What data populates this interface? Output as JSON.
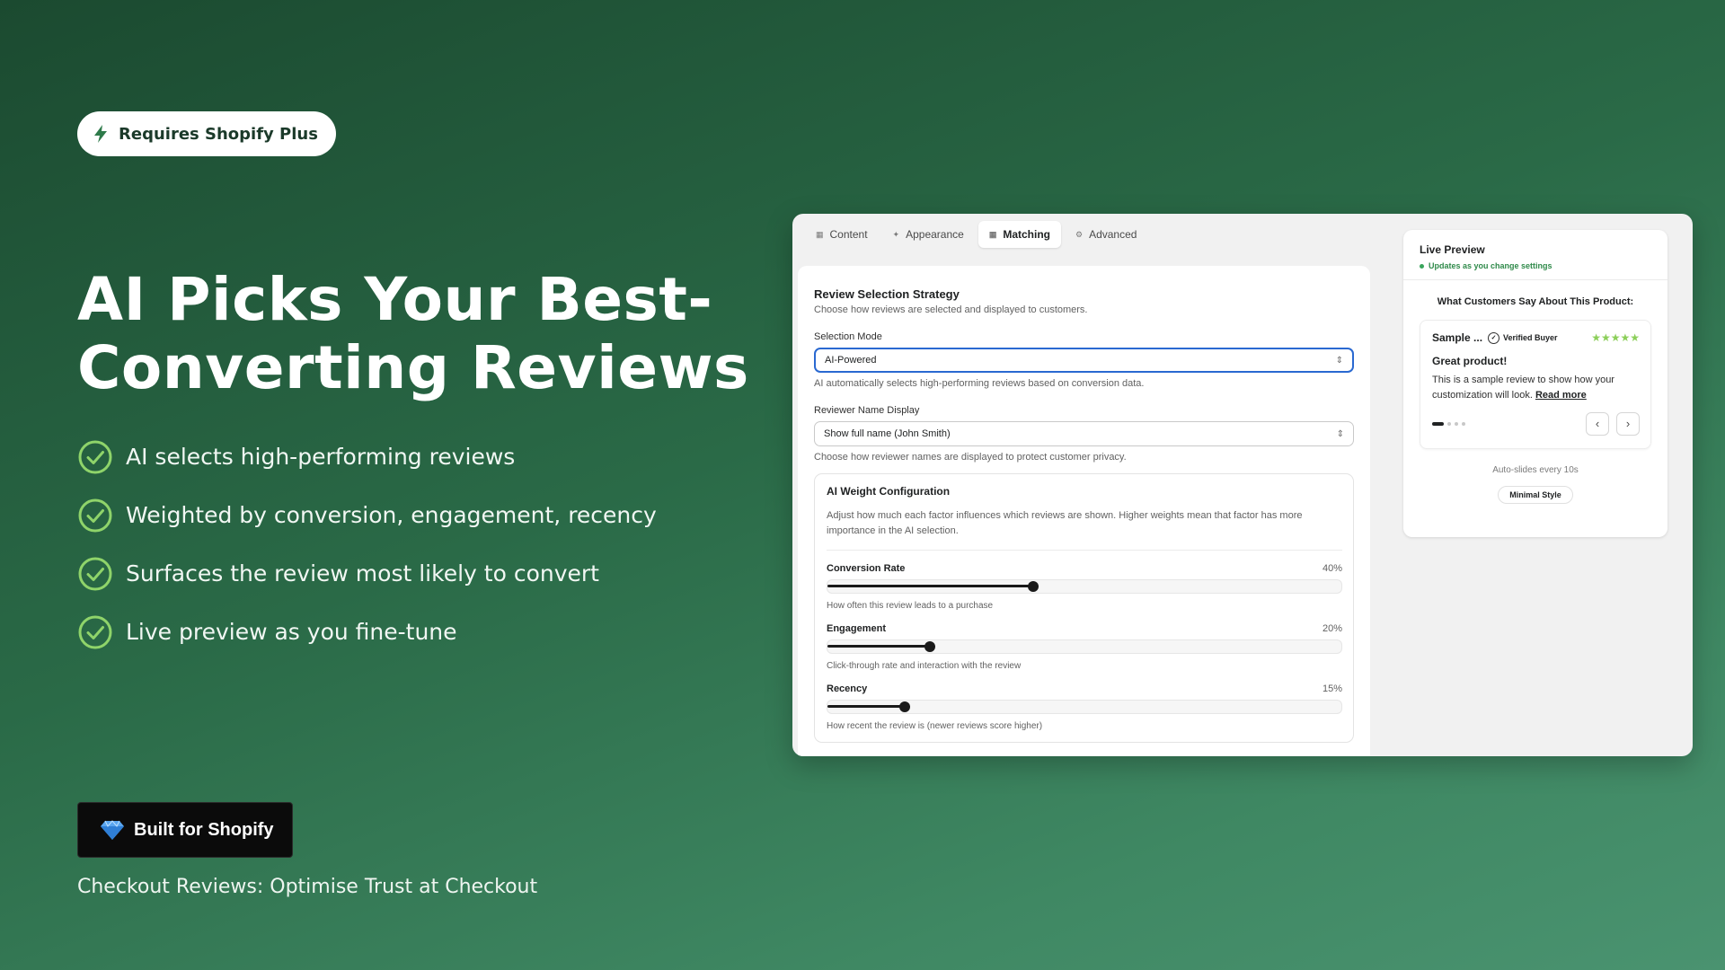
{
  "badge": {
    "label": "Requires Shopify Plus",
    "icon": "lightning-icon"
  },
  "hero": {
    "title": "AI Picks Your Best-Converting Reviews"
  },
  "features": [
    "AI selects high-performing reviews",
    "Weighted by conversion, engagement, recency",
    "Surfaces the review most likely to convert",
    "Live preview as you fine-tune"
  ],
  "shopify_badge": {
    "label": "Built for Shopify",
    "icon": "diamond-icon"
  },
  "footer": {
    "title": "Checkout Reviews: Optimise Trust at Checkout"
  },
  "app": {
    "tabs": [
      {
        "label": "Content",
        "icon": "content-icon"
      },
      {
        "label": "Appearance",
        "icon": "sparkle-icon"
      },
      {
        "label": "Matching",
        "icon": "grid-icon",
        "active": true
      },
      {
        "label": "Advanced",
        "icon": "gear-icon"
      }
    ],
    "strategy": {
      "title": "Review Selection Strategy",
      "subtitle": "Choose how reviews are selected and displayed to customers.",
      "selection_mode_label": "Selection Mode",
      "selection_mode_value": "AI-Powered",
      "selection_mode_help": "AI automatically selects high-performing reviews based on conversion data.",
      "name_display_label": "Reviewer Name Display",
      "name_display_value": "Show full name (John Smith)",
      "name_display_help": "Choose how reviewer names are displayed to protect customer privacy."
    },
    "weights": {
      "title": "AI Weight Configuration",
      "description": "Adjust how much each factor influences which reviews are shown. Higher weights mean that factor has more importance in the AI selection.",
      "items": [
        {
          "name": "Conversion Rate",
          "value_label": "40%",
          "level": 0.4,
          "help": "How often this review leads to a purchase"
        },
        {
          "name": "Engagement",
          "value_label": "20%",
          "level": 0.2,
          "help": "Click-through rate and interaction with the review"
        },
        {
          "name": "Recency",
          "value_label": "15%",
          "level": 0.15,
          "help": "How recent the review is (newer reviews score higher)"
        }
      ]
    },
    "preview": {
      "title": "Live Preview",
      "subtitle": "Updates as you change settings",
      "question": "What Customers Say About This Product:",
      "review": {
        "name": "Sample ...",
        "verified": "Verified Buyer",
        "stars": "★★★★★",
        "rating": 5,
        "headline": "Great product!",
        "body": "This is a sample review to show how your customization will look.",
        "read_more": "Read more"
      },
      "prev": "‹",
      "next": "›",
      "auto_slide": "Auto-slides every 10s",
      "style": "Minimal Style"
    }
  },
  "colors": {
    "background": "#2a6a47",
    "accent_green": "#8ccf5a",
    "focus_blue": "#2a69d1"
  }
}
